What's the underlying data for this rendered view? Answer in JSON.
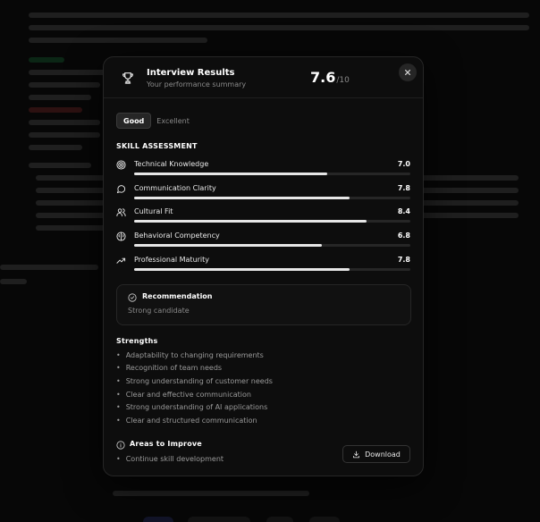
{
  "modal": {
    "title": "Interview Results",
    "subtitle": "Your performance summary",
    "score": "7.6",
    "score_denominator": "/10",
    "close_icon": "close-icon",
    "trophy_icon": "trophy-icon"
  },
  "tabs": {
    "good": "Good",
    "excellent": "Excellent"
  },
  "skills": {
    "title": "SKILL ASSESSMENT",
    "items": [
      {
        "name": "Technical Knowledge",
        "value": "7.0",
        "score": 7.0,
        "icon": "target-icon"
      },
      {
        "name": "Communication Clarity",
        "value": "7.8",
        "score": 7.8,
        "icon": "chat-bubble-icon"
      },
      {
        "name": "Cultural Fit",
        "value": "8.4",
        "score": 8.4,
        "icon": "users-icon"
      },
      {
        "name": "Behavioral Competency",
        "value": "6.8",
        "score": 6.8,
        "icon": "brain-icon"
      },
      {
        "name": "Professional Maturity",
        "value": "7.8",
        "score": 7.8,
        "icon": "trending-up-icon"
      }
    ]
  },
  "recommendation": {
    "title": "Recommendation",
    "text": "Strong candidate",
    "icon": "check-circle-icon"
  },
  "strengths": {
    "title": "Strengths",
    "items": [
      "Adaptability to changing requirements",
      "Recognition of team needs",
      "Strong understanding of customer needs",
      "Clear and effective communication",
      "Strong understanding of AI applications",
      "Clear and structured communication"
    ]
  },
  "improve": {
    "title": "Areas to Improve",
    "items": [
      "Continue skill development"
    ],
    "icon": "info-icon"
  },
  "download": {
    "label": "Download",
    "icon": "download-icon"
  }
}
